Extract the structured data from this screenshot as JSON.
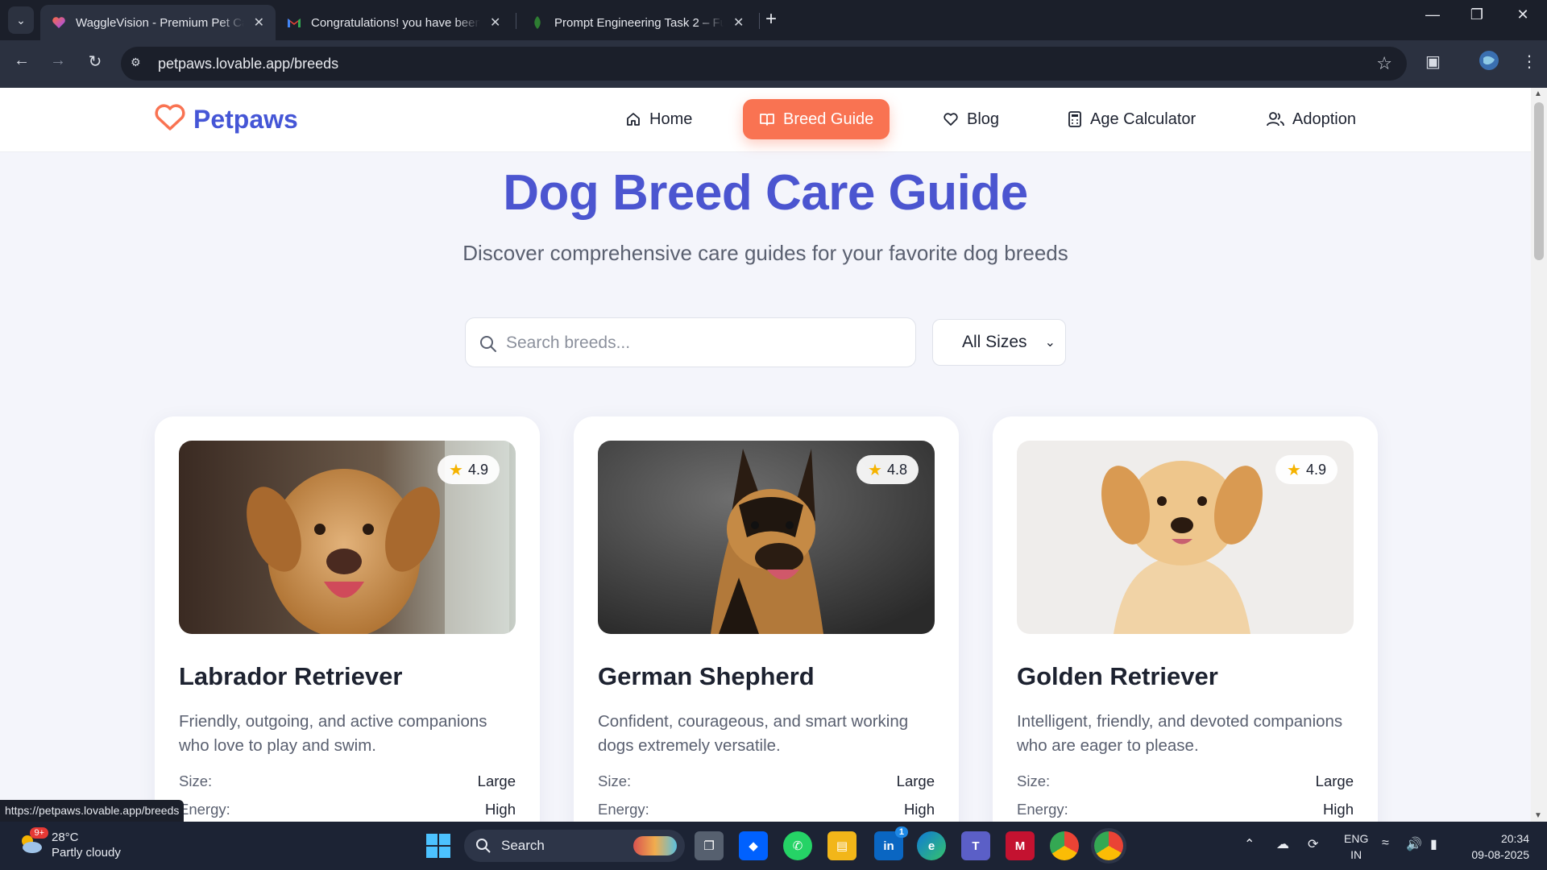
{
  "browser": {
    "tabs": [
      {
        "title": "WaggleVision - Premium Pet Ca",
        "active": true,
        "favicon": "lovable-heart-icon"
      },
      {
        "title": "Congratulations! you have been",
        "active": false,
        "favicon": "gmail-icon"
      },
      {
        "title": "Prompt Engineering Task 2 – Fu",
        "active": false,
        "favicon": "leaf-icon"
      }
    ],
    "url": "petpaws.lovable.app/breeds",
    "status_url": "https://petpaws.lovable.app/breeds"
  },
  "site": {
    "logo_text": "Petpaws",
    "nav": [
      {
        "label": "Home",
        "icon": "home-icon",
        "active": false
      },
      {
        "label": "Breed Guide",
        "icon": "book-icon",
        "active": true
      },
      {
        "label": "Blog",
        "icon": "heart-icon",
        "active": false
      },
      {
        "label": "Age Calculator",
        "icon": "calculator-icon",
        "active": false
      },
      {
        "label": "Adoption",
        "icon": "users-icon",
        "active": false
      }
    ],
    "accent_color": "#f97352",
    "brand_color": "#4556d6"
  },
  "hero": {
    "title": "Dog Breed Care Guide",
    "subtitle": "Discover comprehensive care guides for your favorite dog breeds"
  },
  "filters": {
    "search_placeholder": "Search breeds...",
    "size_selected": "All Sizes"
  },
  "breeds": [
    {
      "name": "Labrador Retriever",
      "rating": "4.9",
      "description": "Friendly, outgoing, and active companions who love to play and swim.",
      "size_label": "Size:",
      "size": "Large",
      "energy_label": "Energy:",
      "energy": "High"
    },
    {
      "name": "German Shepherd",
      "rating": "4.8",
      "description": "Confident, courageous, and smart working dogs extremely versatile.",
      "size_label": "Size:",
      "size": "Large",
      "energy_label": "Energy:",
      "energy": "High"
    },
    {
      "name": "Golden Retriever",
      "rating": "4.9",
      "description": "Intelligent, friendly, and devoted companions who are eager to please.",
      "size_label": "Size:",
      "size": "Large",
      "energy_label": "Energy:",
      "energy": "High"
    }
  ],
  "taskbar": {
    "weather_temp": "28°C",
    "weather_desc": "Partly cloudy",
    "weather_badge": "9+",
    "search_label": "Search",
    "linkedin_badge": "1",
    "lang_line1": "ENG",
    "lang_line2": "IN",
    "time": "20:34",
    "date": "09-08-2025"
  }
}
